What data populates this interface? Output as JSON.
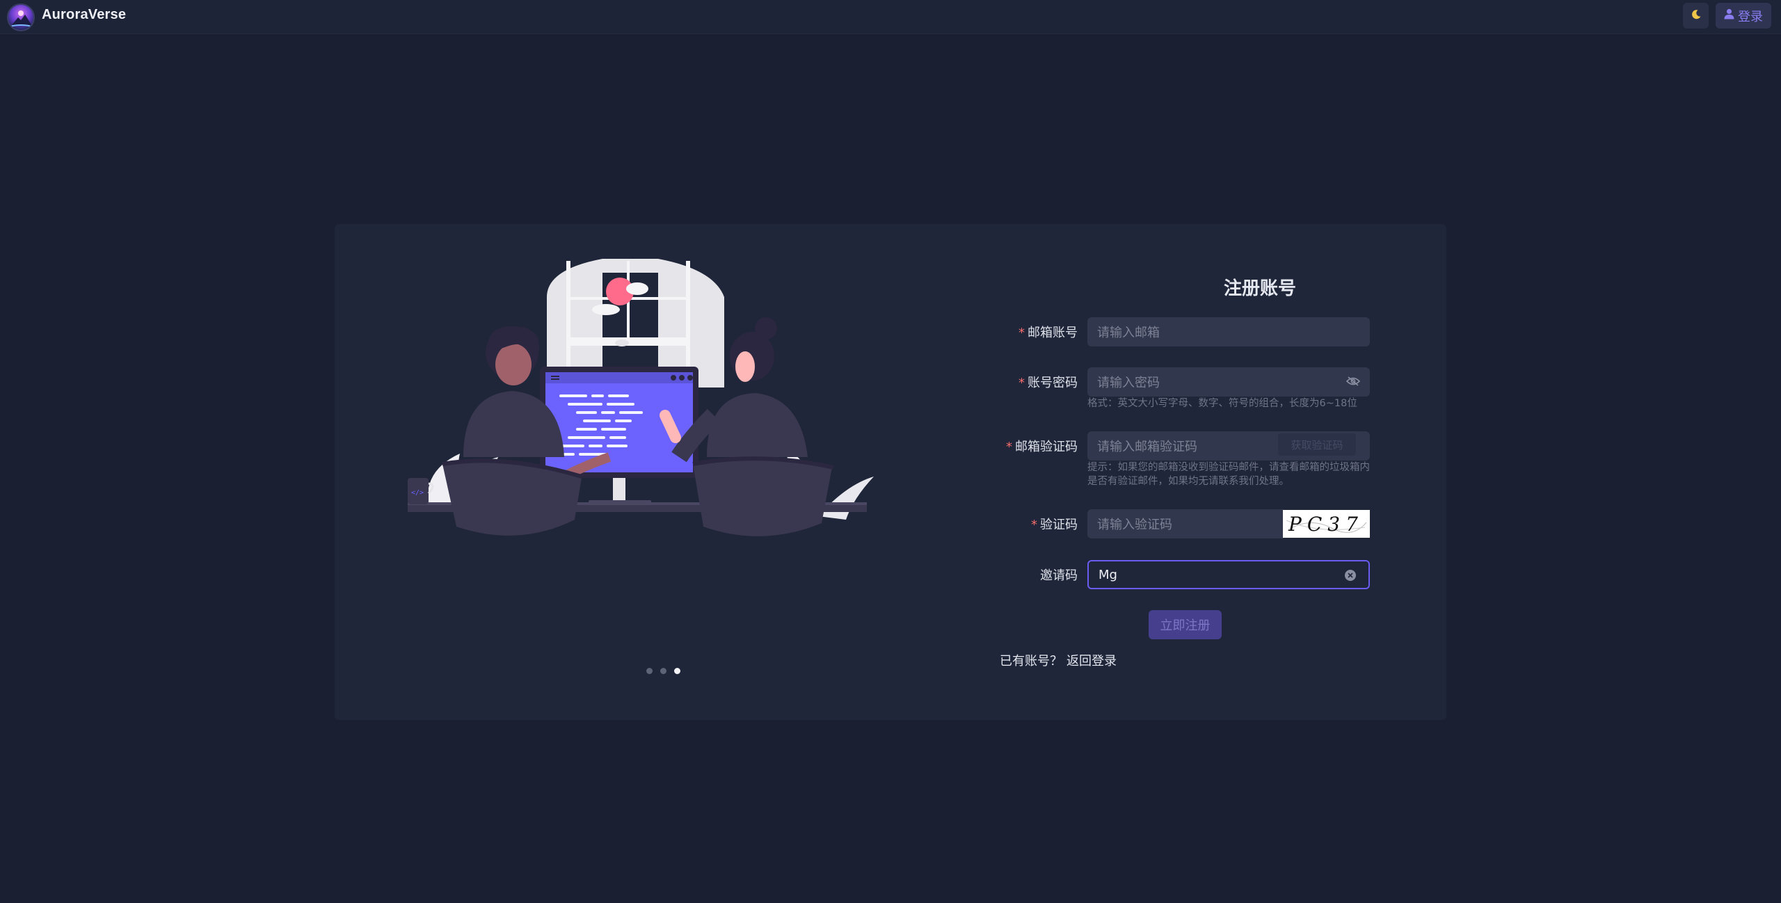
{
  "header": {
    "brand": "AuroraVerse",
    "theme_icon": "moon-icon",
    "login_icon": "user-icon",
    "login_label": "登录"
  },
  "carousel": {
    "slide_count": 3,
    "active_index": 2
  },
  "form": {
    "title": "注册账号",
    "email": {
      "label": "邮箱账号",
      "placeholder": "请输入邮箱"
    },
    "password": {
      "label": "账号密码",
      "placeholder": "请输入密码",
      "hint": "格式：英文大小写字母、数字、符号的组合，长度为6~18位",
      "toggle_icon": "eye-off-icon"
    },
    "email_code": {
      "label": "邮箱验证码",
      "placeholder": "请输入邮箱验证码",
      "send_label": "获取验证码",
      "hint": "提示：如果您的邮箱没收到验证码邮件，请查看邮箱的垃圾箱内是否有验证邮件，如果均无请联系我们处理。"
    },
    "captcha": {
      "label": "验证码",
      "placeholder": "请输入验证码",
      "image_text": "PC37"
    },
    "invite": {
      "label": "邀请码",
      "value": "Mg",
      "clear_icon": "clear-icon"
    },
    "submit_label": "立即注册",
    "has_account_text": "已有账号？",
    "back_login_label": "返回登录"
  },
  "colors": {
    "background": "#1a1f32",
    "card": "#1f2639",
    "accent": "#6a5cf0",
    "required": "#f56c6c"
  }
}
